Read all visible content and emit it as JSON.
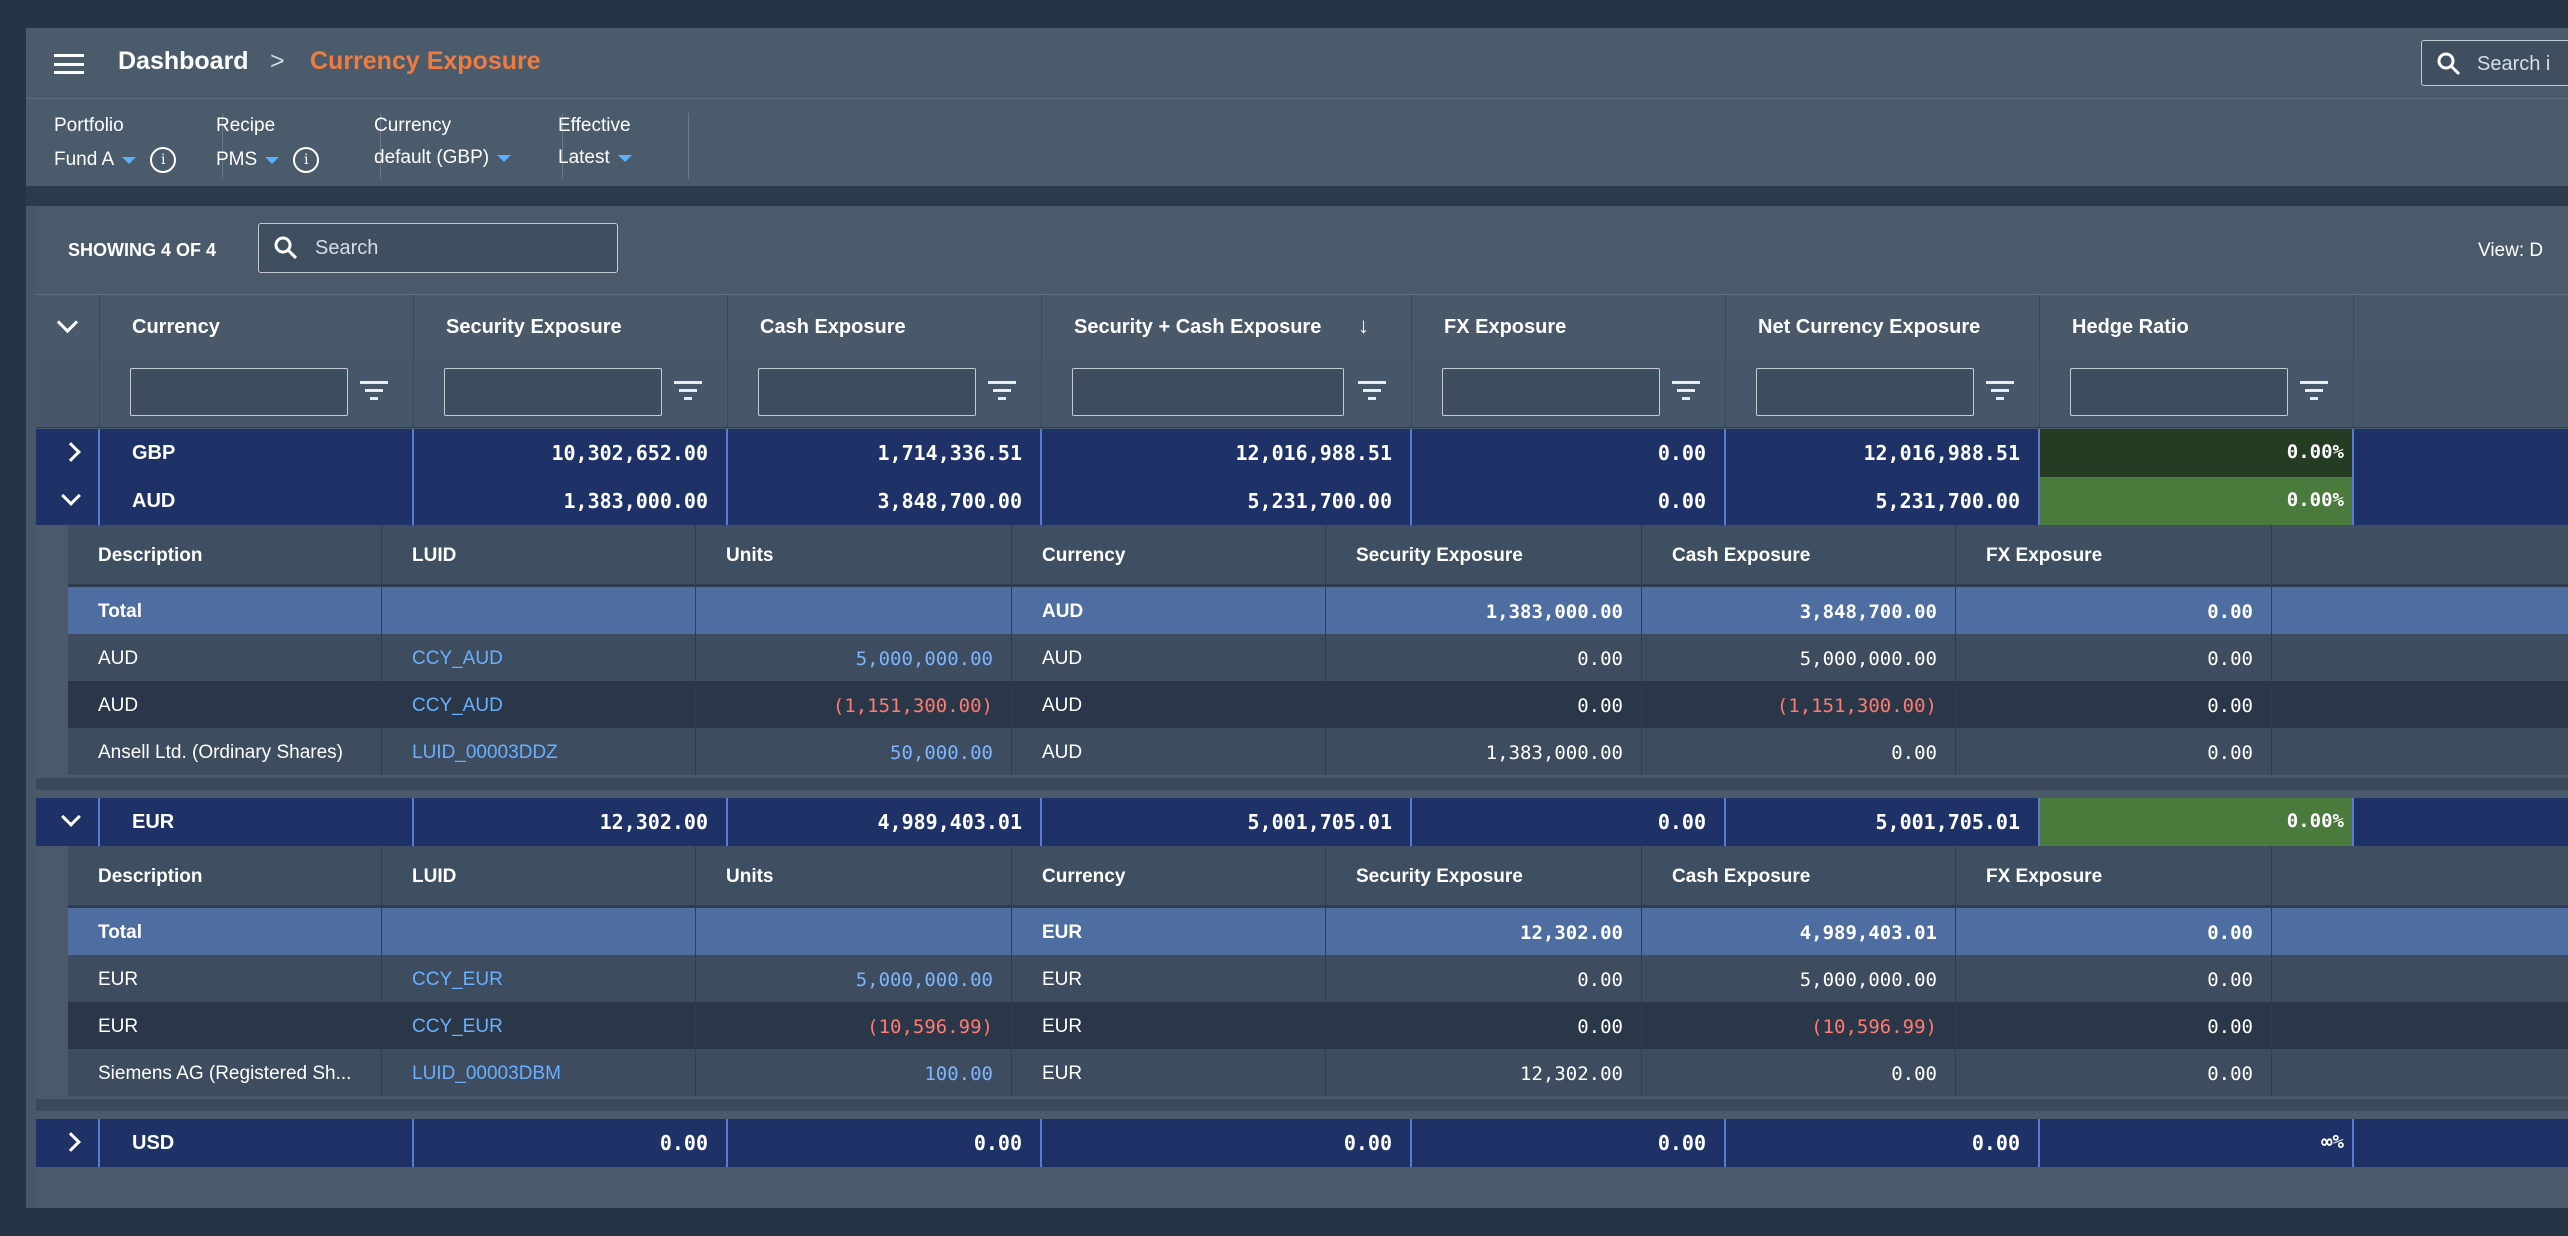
{
  "header": {
    "breadcrumb_home": "Dashboard",
    "breadcrumb_separator": ">",
    "breadcrumb_current": "Currency Exposure",
    "search_placeholder": "Search i"
  },
  "filters": [
    {
      "label": "Portfolio",
      "value": "Fund A",
      "has_info": true
    },
    {
      "label": "Recipe",
      "value": "PMS",
      "has_info": true
    },
    {
      "label": "Currency",
      "value": "default (GBP)",
      "has_info": false
    },
    {
      "label": "Effective",
      "value": "Latest",
      "has_info": false
    }
  ],
  "toolbar": {
    "showing": "SHOWING 4 OF 4",
    "search_placeholder": "Search",
    "view_label": "View: D"
  },
  "columns": [
    "Currency",
    "Security Exposure",
    "Cash Exposure",
    "Security + Cash Exposure",
    "FX Exposure",
    "Net Currency Exposure",
    "Hedge Ratio"
  ],
  "groups": [
    {
      "currency": "GBP",
      "security": "10,302,652.00",
      "cash": "1,714,336.51",
      "sec_cash": "12,016,988.51",
      "fx": "0.00",
      "net": "12,016,988.51",
      "hedge": "0.00%",
      "expanded": false
    },
    {
      "currency": "AUD",
      "security": "1,383,000.00",
      "cash": "3,848,700.00",
      "sec_cash": "5,231,700.00",
      "fx": "0.00",
      "net": "5,231,700.00",
      "hedge": "0.00%",
      "expanded": true
    },
    {
      "currency": "EUR",
      "security": "12,302.00",
      "cash": "4,989,403.01",
      "sec_cash": "5,001,705.01",
      "fx": "0.00",
      "net": "5,001,705.01",
      "hedge": "0.00%",
      "expanded": true
    },
    {
      "currency": "USD",
      "security": "0.00",
      "cash": "0.00",
      "sec_cash": "0.00",
      "fx": "0.00",
      "net": "0.00",
      "hedge": "∞%",
      "expanded": false
    }
  ],
  "detail_columns": [
    "Description",
    "LUID",
    "Units",
    "Currency",
    "Security Exposure",
    "Cash Exposure",
    "FX Exposure"
  ],
  "details": {
    "AUD": [
      {
        "description": "Total",
        "luid": "",
        "units": "",
        "currency": "AUD",
        "security": "1,383,000.00",
        "cash": "3,848,700.00",
        "fx": "0.00"
      },
      {
        "description": "AUD",
        "luid": "CCY_AUD",
        "units": "5,000,000.00",
        "currency": "AUD",
        "security": "0.00",
        "cash": "5,000,000.00",
        "fx": "0.00"
      },
      {
        "description": "AUD",
        "luid": "CCY_AUD",
        "units": "(1,151,300.00)",
        "currency": "AUD",
        "security": "0.00",
        "cash": "(1,151,300.00)",
        "fx": "0.00"
      },
      {
        "description": "Ansell Ltd. (Ordinary Shares)",
        "luid": "LUID_00003DDZ",
        "units": "50,000.00",
        "currency": "AUD",
        "security": "1,383,000.00",
        "cash": "0.00",
        "fx": "0.00"
      }
    ],
    "EUR": [
      {
        "description": "Total",
        "luid": "",
        "units": "",
        "currency": "EUR",
        "security": "12,302.00",
        "cash": "4,989,403.01",
        "fx": "0.00"
      },
      {
        "description": "EUR",
        "luid": "CCY_EUR",
        "units": "5,000,000.00",
        "currency": "EUR",
        "security": "0.00",
        "cash": "5,000,000.00",
        "fx": "0.00"
      },
      {
        "description": "EUR",
        "luid": "CCY_EUR",
        "units": "(10,596.99)",
        "currency": "EUR",
        "security": "0.00",
        "cash": "(10,596.99)",
        "fx": "0.00"
      },
      {
        "description": "Siemens AG (Registered Sh...",
        "luid": "LUID_00003DBM",
        "units": "100.00",
        "currency": "EUR",
        "security": "12,302.00",
        "cash": "0.00",
        "fx": "0.00"
      }
    ]
  },
  "colors": {
    "accent_orange": "#f07b3f",
    "group_row": "#1e3268",
    "hedge_dark": "#243d22",
    "hedge_green": "#4a7a3c",
    "link_blue": "#69b0ff",
    "negative_red": "#ff7b6f",
    "total_row": "#4e6ea2"
  }
}
